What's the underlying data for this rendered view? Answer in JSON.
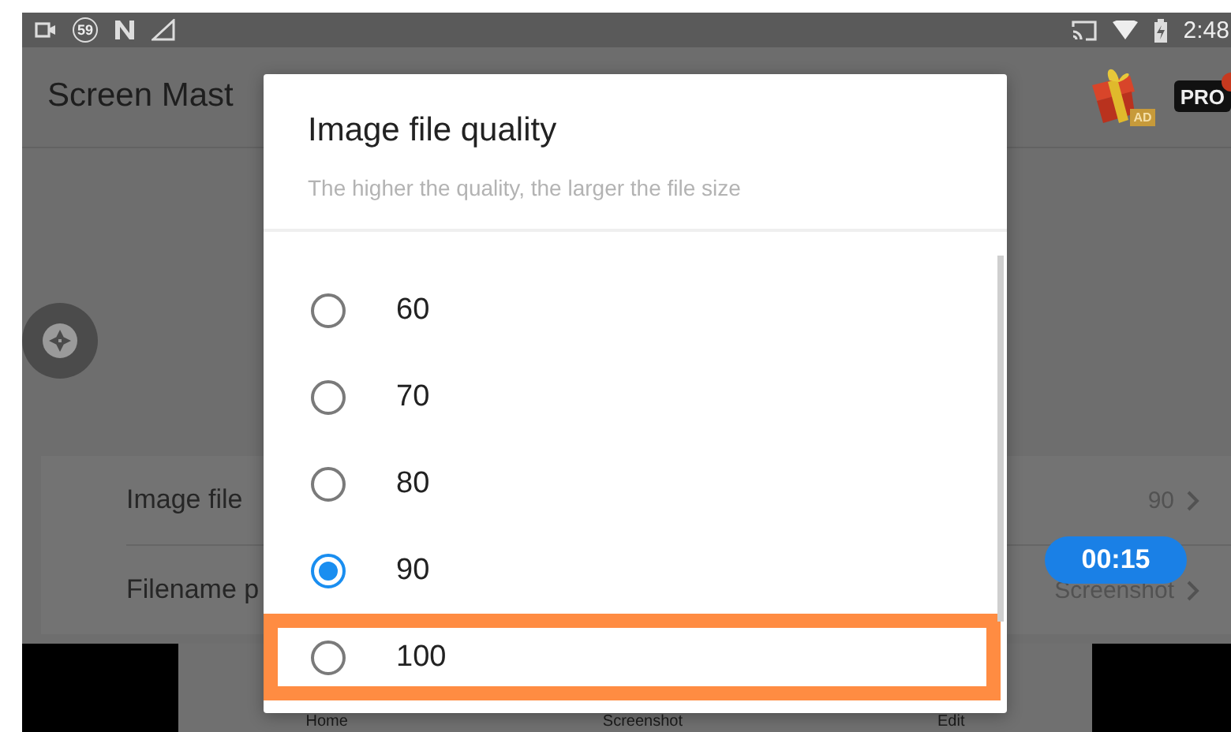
{
  "status_bar": {
    "notification_count": "59",
    "time": "2:48"
  },
  "app_bar": {
    "title": "Screen Mast",
    "ad_label": "AD",
    "badge": "PRO"
  },
  "settings": [
    {
      "label": "Image file",
      "value": "90"
    },
    {
      "label": "Filename p",
      "value": "Screenshot"
    }
  ],
  "timer": "00:15",
  "bottom_nav": [
    {
      "label": "Home"
    },
    {
      "label": "Screenshot"
    },
    {
      "label": "Edit"
    }
  ],
  "dialog": {
    "title": "Image file quality",
    "subtitle": "The higher the quality, the larger the file size",
    "options": [
      {
        "label": "60",
        "selected": false,
        "highlighted": false
      },
      {
        "label": "70",
        "selected": false,
        "highlighted": false
      },
      {
        "label": "80",
        "selected": false,
        "highlighted": false
      },
      {
        "label": "90",
        "selected": true,
        "highlighted": false
      },
      {
        "label": "100",
        "selected": false,
        "highlighted": true
      }
    ]
  }
}
